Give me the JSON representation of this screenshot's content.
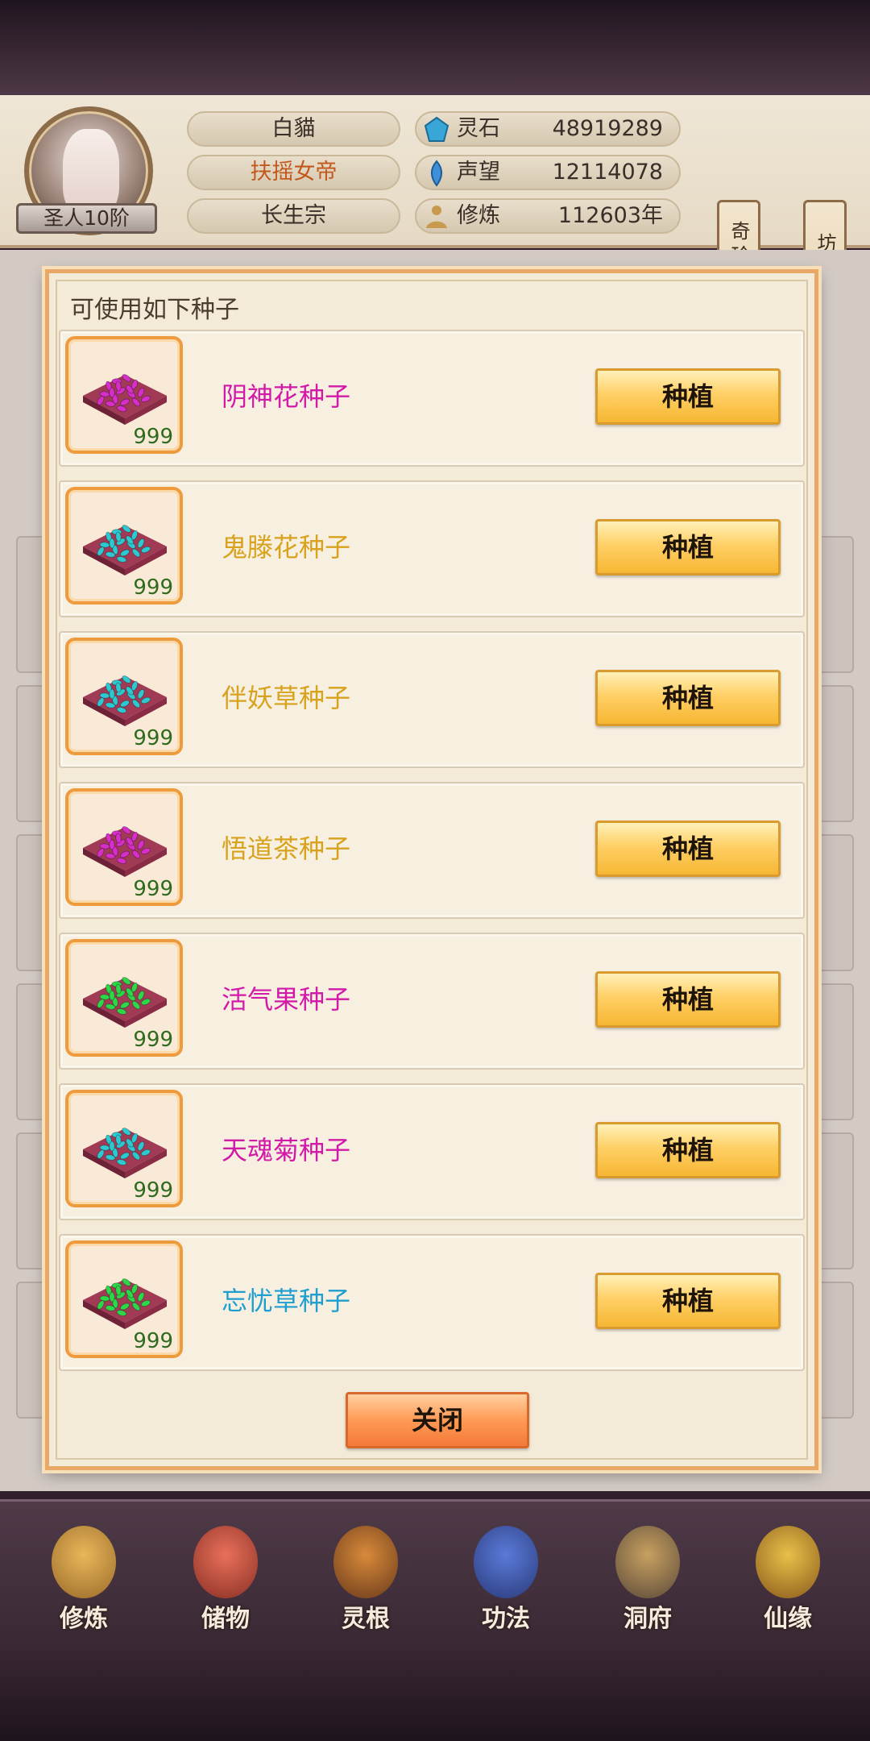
{
  "header": {
    "rank": "圣人10阶",
    "name": "白貓",
    "title": "扶摇女帝",
    "sect": "长生宗",
    "stats": [
      {
        "icon": "spirit-stone-icon",
        "label": "灵石",
        "value": "48919289"
      },
      {
        "icon": "reputation-icon",
        "label": "声望",
        "value": "12114078"
      },
      {
        "icon": "cultivation-icon",
        "label": "修炼",
        "value": "112603年"
      }
    ],
    "side_buttons": [
      "奇珍会",
      "坊市"
    ]
  },
  "modal": {
    "title": "可使用如下种子",
    "seeds": [
      {
        "name": "阴神花种子",
        "count": "999",
        "name_color": "#d21aa8",
        "seed_color": "#d62ec8"
      },
      {
        "name": "鬼滕花种子",
        "count": "999",
        "name_color": "#d8a21c",
        "seed_color": "#2ec9d0"
      },
      {
        "name": "伴妖草种子",
        "count": "999",
        "name_color": "#d8a21c",
        "seed_color": "#2ec9d0"
      },
      {
        "name": "悟道茶种子",
        "count": "999",
        "name_color": "#d8a21c",
        "seed_color": "#d62ec8"
      },
      {
        "name": "活气果种子",
        "count": "999",
        "name_color": "#d21aa8",
        "seed_color": "#2ed64a"
      },
      {
        "name": "天魂菊种子",
        "count": "999",
        "name_color": "#d21aa8",
        "seed_color": "#2ec9d0"
      },
      {
        "name": "忘忧草种子",
        "count": "999",
        "name_color": "#1e9fd0",
        "seed_color": "#2ed64a"
      }
    ],
    "plant_label": "种植",
    "close_label": "关闭"
  },
  "nav": [
    {
      "label": "修炼",
      "icon": "cultivate-icon"
    },
    {
      "label": "储物",
      "icon": "storage-bag-icon"
    },
    {
      "label": "灵根",
      "icon": "spirit-root-icon"
    },
    {
      "label": "功法",
      "icon": "technique-book-icon"
    },
    {
      "label": "洞府",
      "icon": "cave-mansion-icon"
    },
    {
      "label": "仙缘",
      "icon": "immortal-fate-icon"
    }
  ]
}
